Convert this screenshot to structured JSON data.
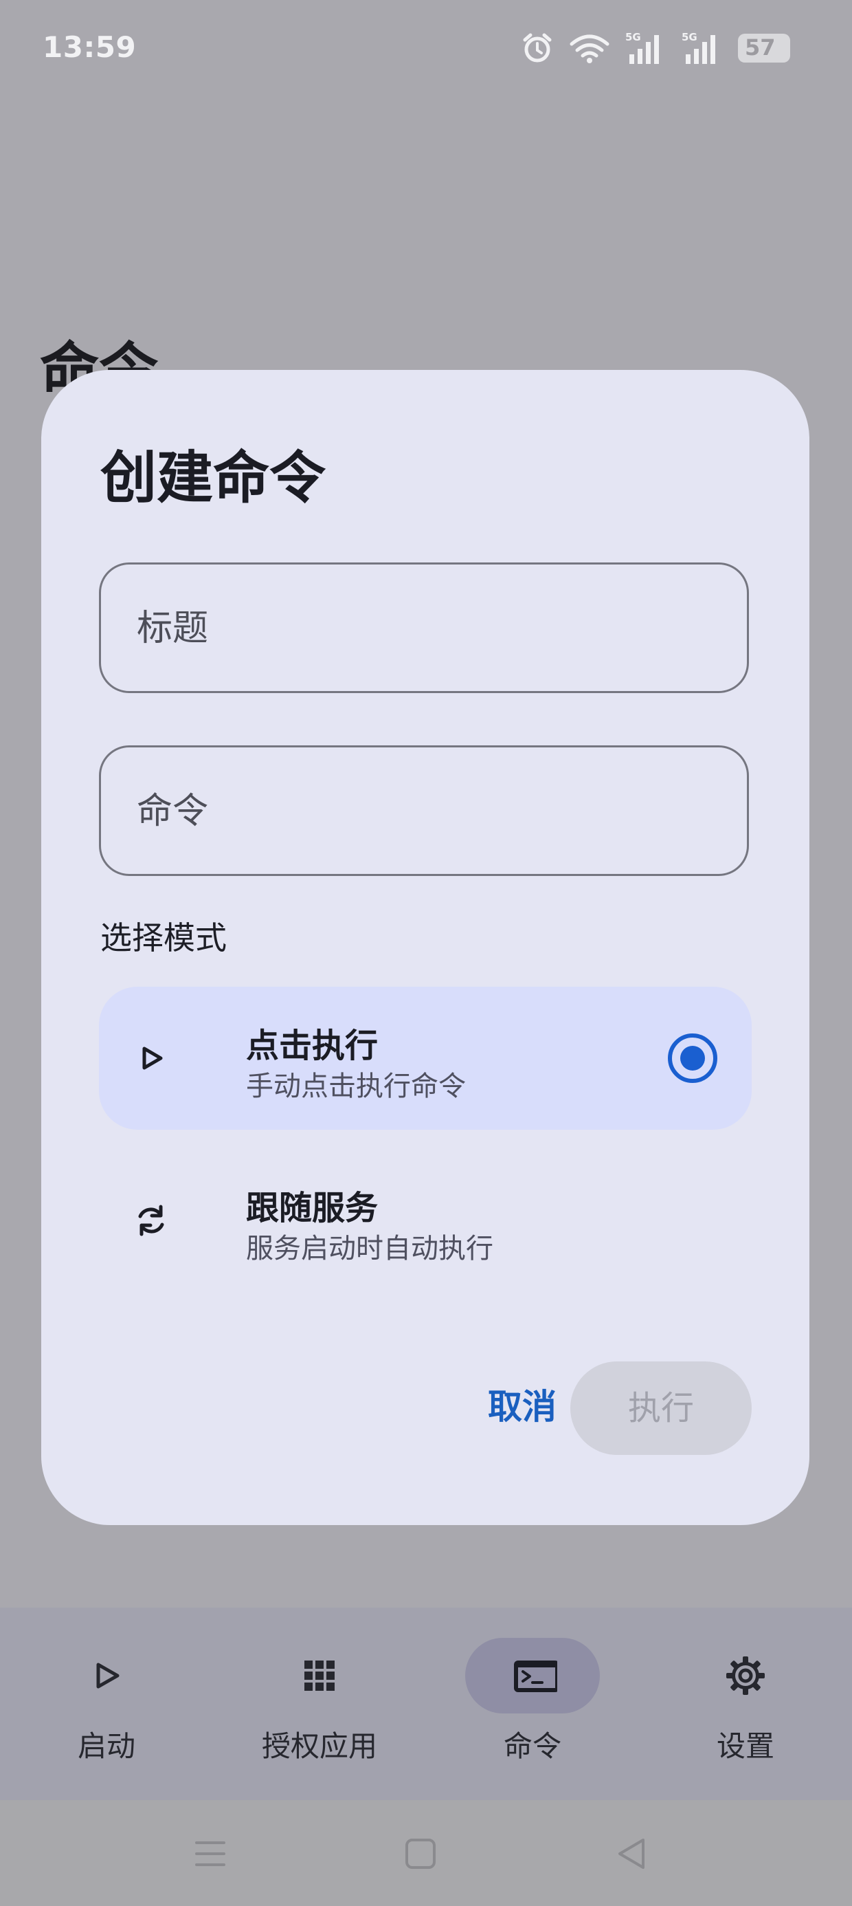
{
  "status_bar": {
    "time": "13:59",
    "icons": [
      "alarm-icon",
      "wifi-icon",
      "signal-5g-icon",
      "signal-5g-icon",
      "battery-icon"
    ],
    "battery_level": "57"
  },
  "background": {
    "page_title": "命令"
  },
  "dialog": {
    "title": "创建命令",
    "title_field": {
      "placeholder": "标题",
      "value": ""
    },
    "command_field": {
      "placeholder": "命令",
      "value": ""
    },
    "mode_label": "选择模式",
    "options": [
      {
        "title": "点击执行",
        "description": "手动点击执行命令",
        "icon": "play-icon",
        "selected": true
      },
      {
        "title": "跟随服务",
        "description": "服务启动时自动执行",
        "icon": "sync-icon",
        "selected": false
      }
    ],
    "cancel_label": "取消",
    "execute_label": "执行"
  },
  "bottom_nav": {
    "items": [
      {
        "label": "启动",
        "icon": "play-icon",
        "active": false
      },
      {
        "label": "授权应用",
        "icon": "grid-icon",
        "active": false
      },
      {
        "label": "命令",
        "icon": "terminal-icon",
        "active": true
      },
      {
        "label": "设置",
        "icon": "gear-icon",
        "active": false
      }
    ]
  },
  "system_nav": {
    "buttons": [
      "menu-icon",
      "home-icon",
      "back-icon"
    ]
  },
  "colors": {
    "scrim": "#a9a8ae",
    "dialog_bg": "#e4e5f3",
    "accent": "#1a5fd0",
    "selected_option_bg": "#d8ddfb",
    "disabled_button_bg": "#d1d2dc"
  }
}
